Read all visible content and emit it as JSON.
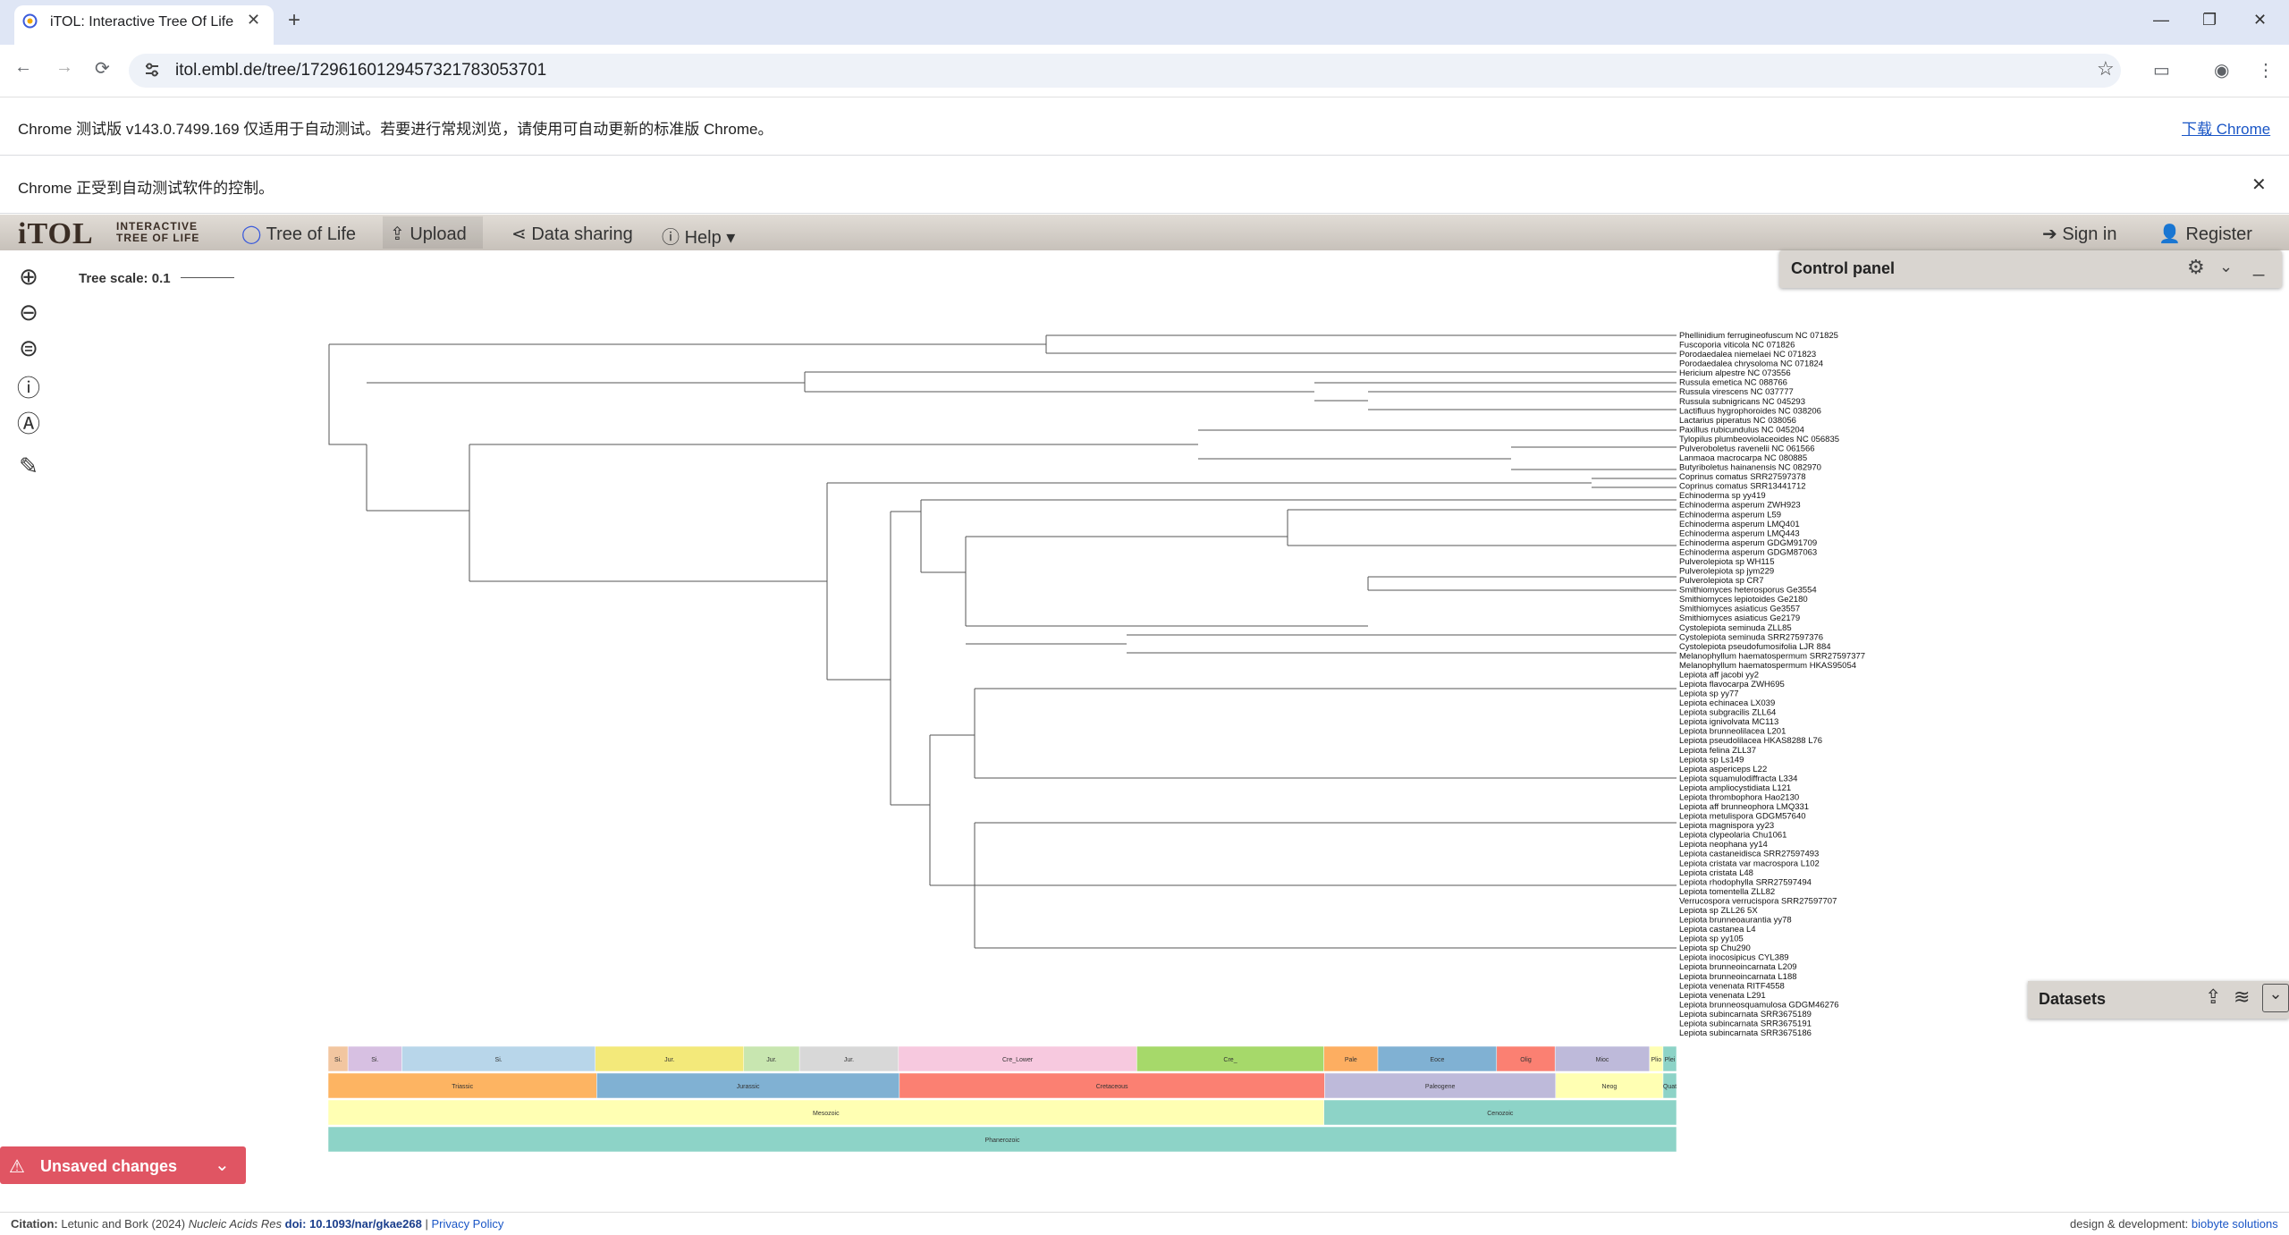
{
  "browser": {
    "tab_title": "iTOL: Interactive Tree Of Life",
    "url": "itol.embl.de/tree/17296160129457321783053701",
    "infobar_text": "Chrome 测试版 v143.0.7499.169 仅适用于自动测试。若要进行常规浏览，请使用可自动更新的标准版 Chrome。",
    "infobar_link": "下载 Chrome",
    "automation_text": "Chrome 正受到自动测试软件的控制。"
  },
  "nav": {
    "logo": "iTOL",
    "logo_sub1": "INTERACTIVE",
    "logo_sub2": "TREE OF LIFE",
    "tree_of_life": "Tree of Life",
    "upload": "Upload",
    "data_sharing": "Data sharing",
    "help": "Help",
    "sign_in": "Sign in",
    "register": "Register"
  },
  "tree": {
    "scale_label": "Tree scale: 0.1",
    "leaves": [
      "Phellinidium ferrugineofuscum NC 071825",
      "Fuscoporia viticola NC 071826",
      "Porodaedalea niemelaei NC 071823",
      "Porodaedalea chrysoloma NC 071824",
      "Hericium alpestre NC 073556",
      "Russula emetica NC 088766",
      "Russula virescens NC 037777",
      "Russula subnigricans NC 045293",
      "Lactifluus hygrophoroides NC 038206",
      "Lactarius piperatus NC 038056",
      "Paxillus rubicundulus NC 045204",
      "Tylopilus plumbeoviolaceoides NC 056835",
      "Pulveroboletus ravenelii NC 061566",
      "Lanmaoa macrocarpa NC 080885",
      "Butyriboletus hainanensis NC 082970",
      "Coprinus comatus SRR27597378",
      "Coprinus comatus SRR13441712",
      "Echinoderma sp  yy419",
      "Echinoderma asperum ZWH923",
      "Echinoderma asperum L59",
      "Echinoderma asperum LMQ401",
      "Echinoderma asperum LMQ443",
      "Echinoderma asperum GDGM91709",
      "Echinoderma asperum GDGM87063",
      "Pulverolepiota sp WH115",
      "Pulverolepiota sp  jym229",
      "Pulverolepiota sp CR7",
      "Smithiomyces heterosporus Ge3554",
      "Smithiomyces lepiotoides Ge2180",
      "Smithiomyces asiaticus Ge3557",
      "Smithiomyces asiaticus Ge2179",
      "Cystolepiota seminuda ZLL85",
      "Cystolepiota seminuda SRR27597376",
      "Cystolepiota pseudofumosifolia LJR 884",
      "Melanophyllum haematospermum SRR27597377",
      "Melanophyllum haematospermum HKAS95054",
      "Lepiota aff  jacobi yy2",
      "Lepiota flavocarpa ZWH695",
      "Lepiota sp  yy77",
      "Lepiota echinacea LX039",
      "Lepiota subgracilis ZLL64",
      "Lepiota ignivolvata MC113",
      "Lepiota brunneolilacea L201",
      "Lepiota pseudolilacea HKAS8288 L76",
      "Lepiota felina ZLL37",
      "Lepiota sp  Ls149",
      "Lepiota aspericeps L22",
      "Lepiota squamulodiffracta L334",
      "Lepiota ampliocystidiata L121",
      "Lepiota thrombophora Hao2130",
      "Lepiota aff  brunneophora LMQ331",
      "Lepiota metulispora GDGM57640",
      "Lepiota magnispora yy23",
      "Lepiota clypeolaria Chu1061",
      "Lepiota neophana yy14",
      "Lepiota castaneidisca SRR27597493",
      "Lepiota cristata var  macrospora L102",
      "Lepiota cristata L48",
      "Lepiota rhodophylla SRR27597494",
      "Lepiota tomentella ZLL82",
      "Verrucospora verrucispora SRR27597707",
      "Lepiota sp  ZLL26 5X",
      "Lepiota brunneoaurantia yy78",
      "Lepiota castanea L4",
      "Lepiota sp  yy105",
      "Lepiota sp  Chu290",
      "Lepiota inocosipicus CYL389",
      "Lepiota brunneoincarnata L209",
      "Lepiota brunneoincarnata L188",
      "Lepiota venenata RITF4558",
      "Lepiota venenata L291",
      "Lepiota brunneosquamulosa GDGM46276",
      "Lepiota subincarnata SRR3675189",
      "Lepiota subincarnata SRR3675191",
      "Lepiota subincarnata SRR3675186"
    ]
  },
  "timescale": {
    "row1": [
      "Si.",
      "Si.",
      "Si.",
      "Jur.",
      "Jur.",
      "Jur.",
      "Cre_Lower",
      "Cre_",
      "Pale",
      "Eoce",
      "Olig",
      "Mioc",
      "Plio",
      "Plei"
    ],
    "row2": [
      "Triassic",
      "Jurassic",
      "Cretaceous",
      "Paleogene",
      "Neog",
      "Quat"
    ],
    "row3": [
      "Mesozoic",
      "Cenozoic"
    ],
    "row4": [
      "Phanerozoic"
    ],
    "colors": {
      "row1": [
        "#f2c6a0",
        "#d7c0e2",
        "#b8d6ea",
        "#f3e97a",
        "#c8e6b0",
        "#d8d8d8",
        "#f7c9df",
        "#a6d96a",
        "#fdae61",
        "#80b1d3",
        "#fb8072",
        "#bebada",
        "#ffffb3",
        "#8dd3c7"
      ],
      "row2": [
        "#fdb462",
        "#80b1d3",
        "#fb8072",
        "#bebada",
        "#ffffb3",
        "#8dd3c7"
      ],
      "row3": [
        "#ffffb3",
        "#8dd3c7"
      ],
      "row4": [
        "#8dd3c7"
      ]
    }
  },
  "panels": {
    "control_panel": "Control panel",
    "datasets": "Datasets",
    "unsaved": "Unsaved changes"
  },
  "footer": {
    "citation_label": "Citation:",
    "citation_text": "Letunic and Bork (2024)",
    "journal": "Nucleic Acids Res",
    "doi": "doi: 10.1093/nar/gkae268",
    "privacy": "Privacy Policy",
    "design_label": "design & development:",
    "design_link": "biobyte solutions"
  }
}
